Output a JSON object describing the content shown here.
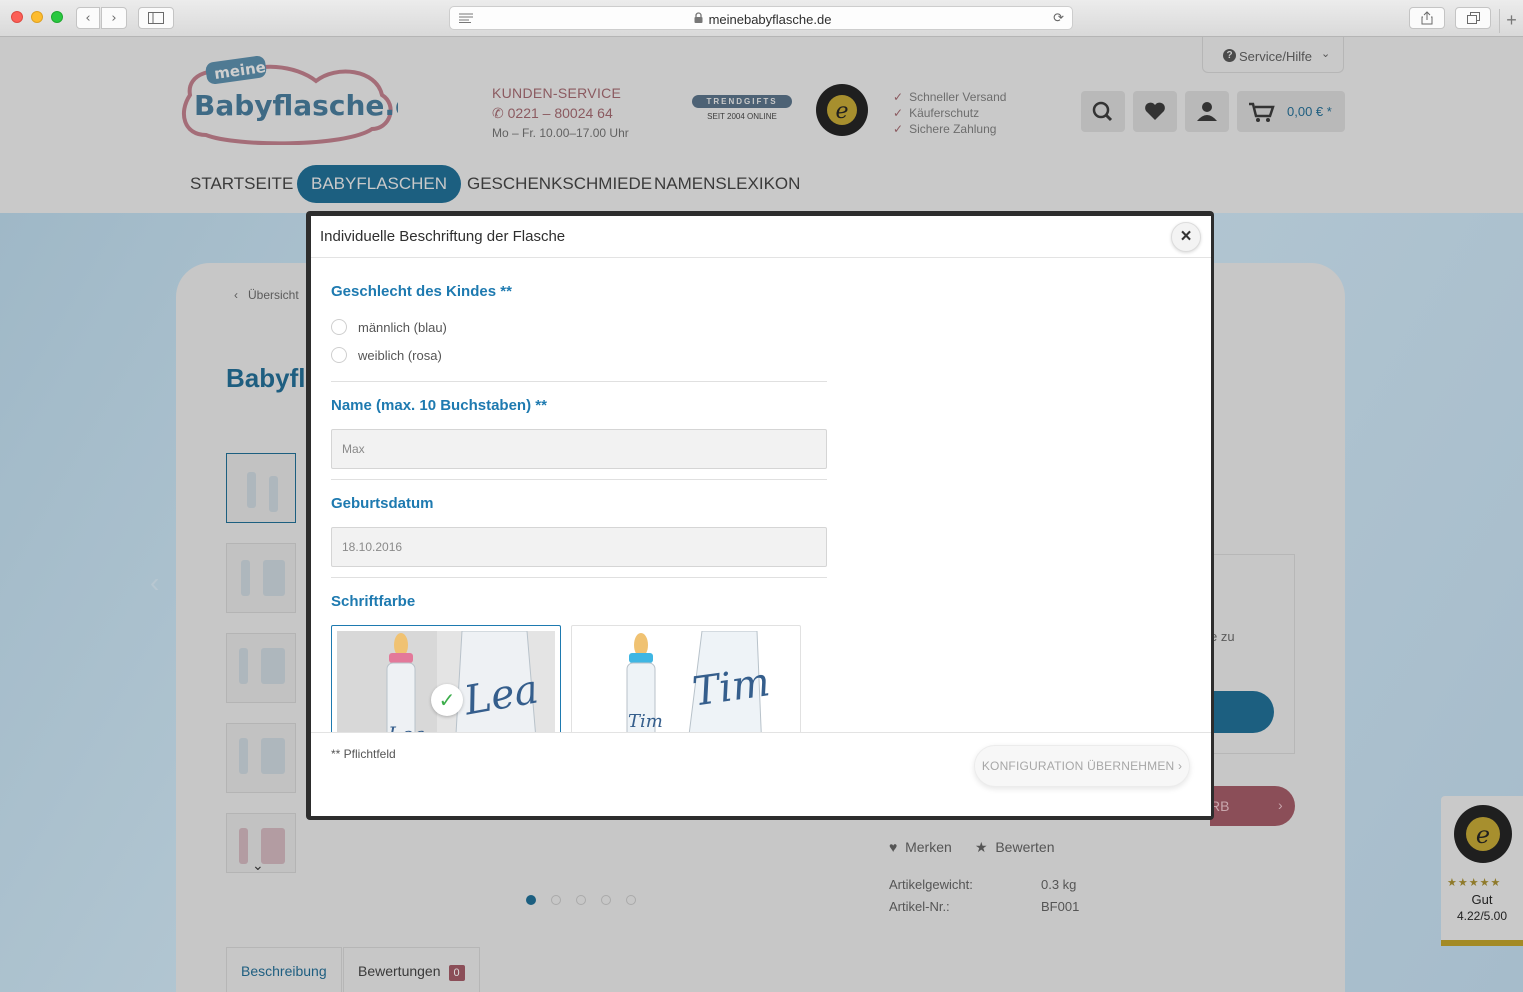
{
  "browser": {
    "url": "meinebabyflasche.de",
    "back": "‹",
    "forward": "›",
    "new_tab": "+"
  },
  "header": {
    "service_label": "Service/Hilfe",
    "kunden_title": "KUNDEN-SERVICE",
    "phone": "0221 – 80024 64",
    "hours": "Mo – Fr. 10.00–17.00 Uhr",
    "trendgifts": "TRENDGIFTS",
    "trendgifts_sub": "SEIT 2004 ONLINE",
    "usps": [
      "Schneller Versand",
      "Käuferschutz",
      "Sichere Zahlung"
    ],
    "cart_amount": "0,00 € *",
    "logo_small": "meine",
    "logo_main": "Babyflasche.de"
  },
  "nav": {
    "items": [
      "STARTSEITE",
      "BABYFLASCHEN",
      "GESCHENKSCHMIEDE",
      "NAMENSLEXIKON"
    ],
    "active_index": 1
  },
  "product_bg": {
    "back_link": "Übersicht",
    "title": "Babyfla",
    "side_text": "e zu",
    "buy_suffix": "RB",
    "merken": "Merken",
    "bewerten": "Bewerten",
    "gewicht_label": "Artikelgewicht:",
    "gewicht_value": "0.3 kg",
    "nr_label": "Artikel-Nr.:",
    "nr_value": "BF001",
    "tab_beschreibung": "Beschreibung",
    "tab_bewertungen": "Bewertungen",
    "bewertungen_count": "0"
  },
  "trusted_widget": {
    "stars": "★★★★★",
    "rating_word": "Gut",
    "score": "4.22/5.00"
  },
  "modal": {
    "title": "Individuelle Beschriftung der Flasche",
    "close": "×",
    "gender_label": "Geschlecht des Kindes **",
    "gender_options": [
      "männlich (blau)",
      "weiblich (rosa)"
    ],
    "name_label": "Name (max. 10 Buchstaben) **",
    "name_placeholder": "Max",
    "date_label": "Geburtsdatum",
    "date_placeholder": "18.10.2016",
    "color_label": "Schriftfarbe",
    "swatch_left_text": "Lea",
    "swatch_right_text": "Tim",
    "required_note": "** Pflichtfeld",
    "apply_button": "KONFIGURATION ÜBERNEHMEN ›"
  },
  "colors": {
    "brand_blue": "#1e7ab0",
    "nav_blue": "#1c5f80",
    "check_green": "#3cad4b",
    "pink": "#e3799a"
  }
}
